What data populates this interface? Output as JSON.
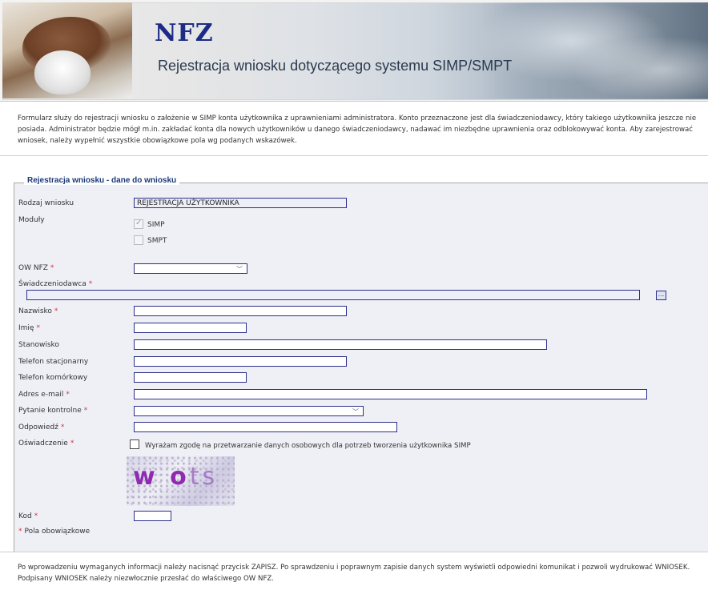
{
  "header": {
    "logo": "NFZ",
    "title": "Rejestracja wniosku dotyczącego systemu SIMP/SMPT"
  },
  "intro_text": "Formularz służy do rejestracji wniosku o założenie w  SIMP konta użytkownika z uprawnieniami administratora. Konto przeznaczone jest dla świadczeniodawcy, który takiego użytkownika jeszcze nie posiada. Administrator będzie mógł m.in. zakładać konta dla nowych użytkowników u danego świadczeniodawcy, nadawać im niezbędne uprawnienia oraz odblokowywać konta. Aby zarejestrować wniosek, należy wypełnić wszystkie obowiązkowe pola wg podanych wskazówek.",
  "form": {
    "legend": "Rejestracja wniosku - dane do wniosku",
    "required_mark": "*",
    "rodzaj_label": "Rodzaj wniosku",
    "rodzaj_value": "REJESTRACJA UŻYTKOWNIKA",
    "moduly_label": "Moduły",
    "modules": [
      {
        "label": "SIMP",
        "checked": true
      },
      {
        "label": "SMPT",
        "checked": false
      }
    ],
    "ow_label": "OW NFZ",
    "ow_value": "",
    "swiadczeniodawca_label": "Świadczeniodawca",
    "lookup_button": "...",
    "nazwisko_label": "Nazwisko",
    "imie_label": "Imię",
    "stanowisko_label": "Stanowisko",
    "tel_stac_label": "Telefon stacjonarny",
    "tel_kom_label": "Telefon komórkowy",
    "email_label": "Adres e-mail",
    "pytanie_label": "Pytanie kontrolne",
    "pytanie_value": "",
    "odpowiedz_label": "Odpowiedź",
    "oswiadczenie_label": "Oświadczenie",
    "oswiadczenie_text": "Wyrażam zgodę na przetwarzanie danych osobowych dla potrzeb tworzenia użytkownika  SIMP",
    "captcha_text": "w ots",
    "kod_label": "Kod",
    "required_note": "Pola obowiązkowe"
  },
  "outro_text": "Po wprowadzeniu wymaganych informacji należy nacisnąć przycisk ZAPISZ. Po sprawdzeniu i poprawnym zapisie danych system wyświetli odpowiedni komunikat i pozwoli wydrukować WNIOSEK. Podpisany WNIOSEK należy niezwłocznie przesłać do właściwego OW NFZ.",
  "colors": {
    "brand": "#1c2c86",
    "input_border": "#2d2f8a",
    "required": "#dd3333",
    "legend": "#1b3a77"
  }
}
